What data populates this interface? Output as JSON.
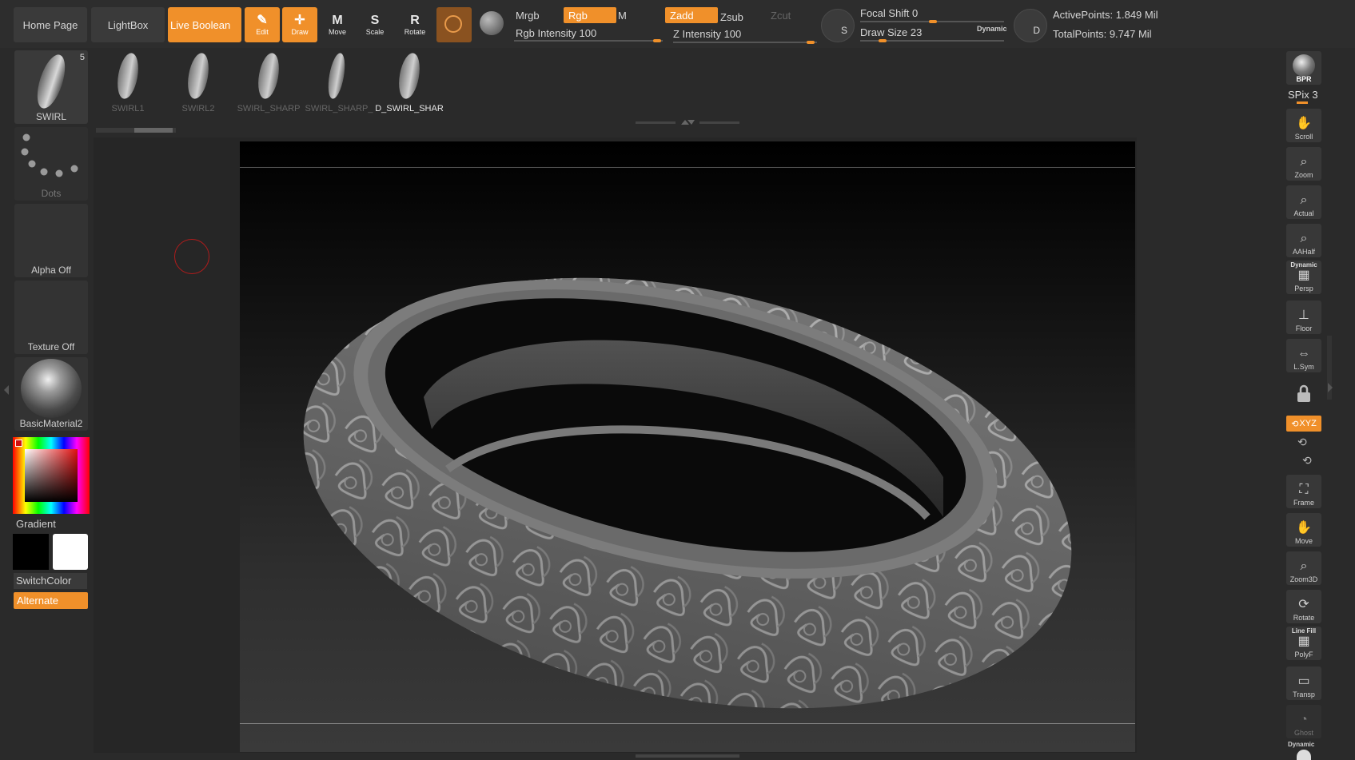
{
  "topbar": {
    "home_page": "Home Page",
    "lightbox": "LightBox",
    "live_boolean": "Live Boolean",
    "tools": [
      {
        "label": "Edit",
        "glyph": "✎",
        "active": true
      },
      {
        "label": "Draw",
        "glyph": "✛",
        "active": true
      },
      {
        "label": "Move",
        "glyph": "M",
        "active": false
      },
      {
        "label": "Scale",
        "glyph": "S",
        "active": false
      },
      {
        "label": "Rotate",
        "glyph": "R",
        "active": false
      }
    ],
    "mrgb": "Mrgb",
    "rgb": "Rgb",
    "m": "M",
    "rgb_intensity": "Rgb Intensity 100",
    "zadd": "Zadd",
    "zsub": "Zsub",
    "zcut": "Zcut",
    "z_intensity": "Z Intensity 100",
    "focal_shift": "Focal Shift 0",
    "draw_size": "Draw Size 23",
    "dynamic": "Dynamic",
    "active_points": "ActivePoints: 1.849 Mil",
    "total_points": "TotalPoints: 9.747 Mil",
    "s_icon_label": "S",
    "d_icon_label": "D"
  },
  "brushes": {
    "current": {
      "label": "SWIRL",
      "count": "5"
    },
    "items": [
      "SWIRL1",
      "SWIRL2",
      "SWIRL_SHARP",
      "SWIRL_SHARP_",
      "D_SWIRL_SHAR"
    ]
  },
  "left": {
    "stroke": "Dots",
    "alpha": "Alpha Off",
    "texture": "Texture Off",
    "material": "BasicMaterial2",
    "gradient": "Gradient",
    "switch_color": "SwitchColor",
    "alternate": "Alternate"
  },
  "right": {
    "bpr": "BPR",
    "spix": "SPix 3",
    "buttons": [
      {
        "label": "Scroll",
        "glyph": "✋",
        "top_label": ""
      },
      {
        "label": "Zoom",
        "glyph": "⌕",
        "top_label": ""
      },
      {
        "label": "Actual",
        "glyph": "⌕",
        "top_label": ""
      },
      {
        "label": "AAHalf",
        "glyph": "⌕",
        "top_label": ""
      },
      {
        "label": "Persp",
        "glyph": "▦",
        "top_label": "Dynamic"
      },
      {
        "label": "Floor",
        "glyph": "⊥",
        "top_label": ""
      },
      {
        "label": "L.Sym",
        "glyph": "⇔",
        "top_label": ""
      }
    ],
    "xyz": "XYZ",
    "buttons2": [
      {
        "label": "Frame",
        "glyph": "⛶",
        "top_label": ""
      },
      {
        "label": "Move",
        "glyph": "✋",
        "top_label": ""
      },
      {
        "label": "Zoom3D",
        "glyph": "⌕",
        "top_label": ""
      },
      {
        "label": "Rotate",
        "glyph": "⟳",
        "top_label": ""
      },
      {
        "label": "PolyF",
        "glyph": "▦",
        "top_label": "Line Fill"
      },
      {
        "label": "Transp",
        "glyph": "▭",
        "top_label": ""
      },
      {
        "label": "Ghost",
        "glyph": "◔",
        "top_label": ""
      }
    ],
    "bottom_dynamic": "Dynamic"
  },
  "colors": {
    "accent": "#f0902a",
    "panel": "#333333",
    "background": "#2a2a2a"
  }
}
